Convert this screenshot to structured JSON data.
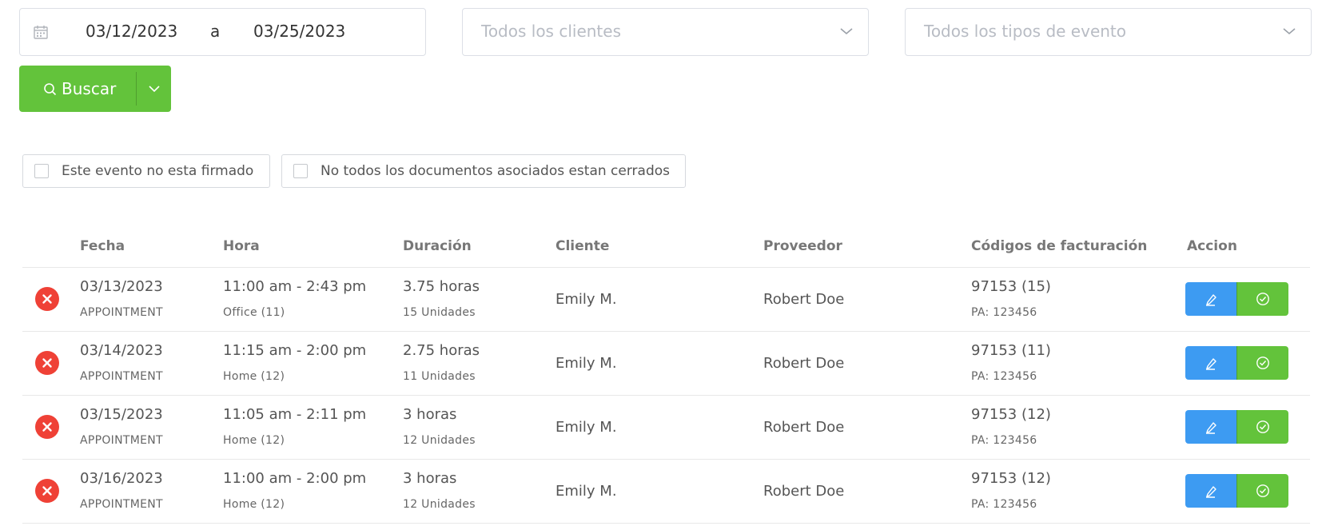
{
  "filters": {
    "date_start": "03/12/2023",
    "date_separator": "a",
    "date_end": "03/25/2023",
    "clients_placeholder": "Todos los clientes",
    "event_types_placeholder": "Todos los tipos de evento"
  },
  "search": {
    "label": "Buscar"
  },
  "checks": {
    "unsigned_label": "Este evento no esta firmado",
    "docs_open_label": "No todos los documentos asociados estan cerrados"
  },
  "table": {
    "headers": {
      "fecha": "Fecha",
      "hora": "Hora",
      "duracion": "Duración",
      "cliente": "Cliente",
      "proveedor": "Proveedor",
      "codigos": "Códigos de facturación",
      "accion": "Accion"
    },
    "rows": [
      {
        "date": "03/13/2023",
        "type": "APPOINTMENT",
        "time": "11:00 am - 2:43 pm",
        "place": "Office (11)",
        "duration": "3.75 horas",
        "units": "15 Unidades",
        "client": "Emily M.",
        "provider": "Robert Doe",
        "code": "97153 (15)",
        "pa": "PA: 123456"
      },
      {
        "date": "03/14/2023",
        "type": "APPOINTMENT",
        "time": "11:15 am - 2:00 pm",
        "place": "Home (12)",
        "duration": "2.75 horas",
        "units": "11 Unidades",
        "client": "Emily M.",
        "provider": "Robert Doe",
        "code": "97153 (11)",
        "pa": "PA: 123456"
      },
      {
        "date": "03/15/2023",
        "type": "APPOINTMENT",
        "time": "11:05 am - 2:11 pm",
        "place": "Home (12)",
        "duration": "3 horas",
        "units": "12 Unidades",
        "client": "Emily M.",
        "provider": "Robert Doe",
        "code": "97153 (12)",
        "pa": "PA: 123456"
      },
      {
        "date": "03/16/2023",
        "type": "APPOINTMENT",
        "time": "11:00 am - 2:00 pm",
        "place": "Home (12)",
        "duration": "3 horas",
        "units": "12 Unidades",
        "client": "Emily M.",
        "provider": "Robert Doe",
        "code": "97153 (12)",
        "pa": "PA: 123456"
      }
    ]
  },
  "colors": {
    "primary_green": "#63c33b",
    "edit_blue": "#3d9bf2",
    "error_red": "#ef4136"
  },
  "icons": {
    "date": "calendar-icon",
    "dropdown": "chevron-down-icon",
    "search": "search-icon",
    "status": "error-x-icon",
    "edit": "pencil-icon",
    "confirm": "check-circle-icon"
  }
}
